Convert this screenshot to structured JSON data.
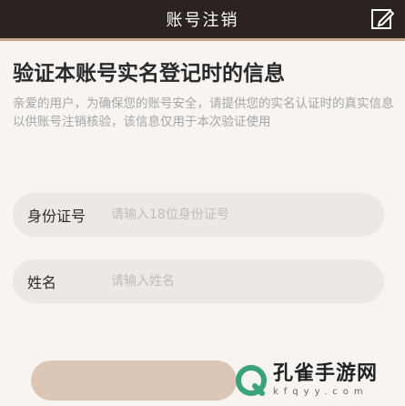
{
  "header": {
    "title": "账号注销",
    "action_icon": "edit-icon"
  },
  "main": {
    "heading": "验证本账号实名登记时的信息",
    "description": "亲爱的用户，为确保您的账号安全，请提供您的实名认证时的真实信息以供账号注销核验，该信息仅用于本次验证使用"
  },
  "form": {
    "id_label": "身份证号",
    "id_placeholder": "请输入18位身份证号",
    "name_label": "姓名",
    "name_placeholder": "请输入姓名"
  },
  "watermark": {
    "name": "孔雀手游网",
    "url": "kfqyy.com"
  },
  "colors": {
    "header_bg": "#2a2320",
    "accent": "#c5a48a",
    "field_bg": "#ece8e5",
    "button_bg": "#dcc7b6"
  }
}
